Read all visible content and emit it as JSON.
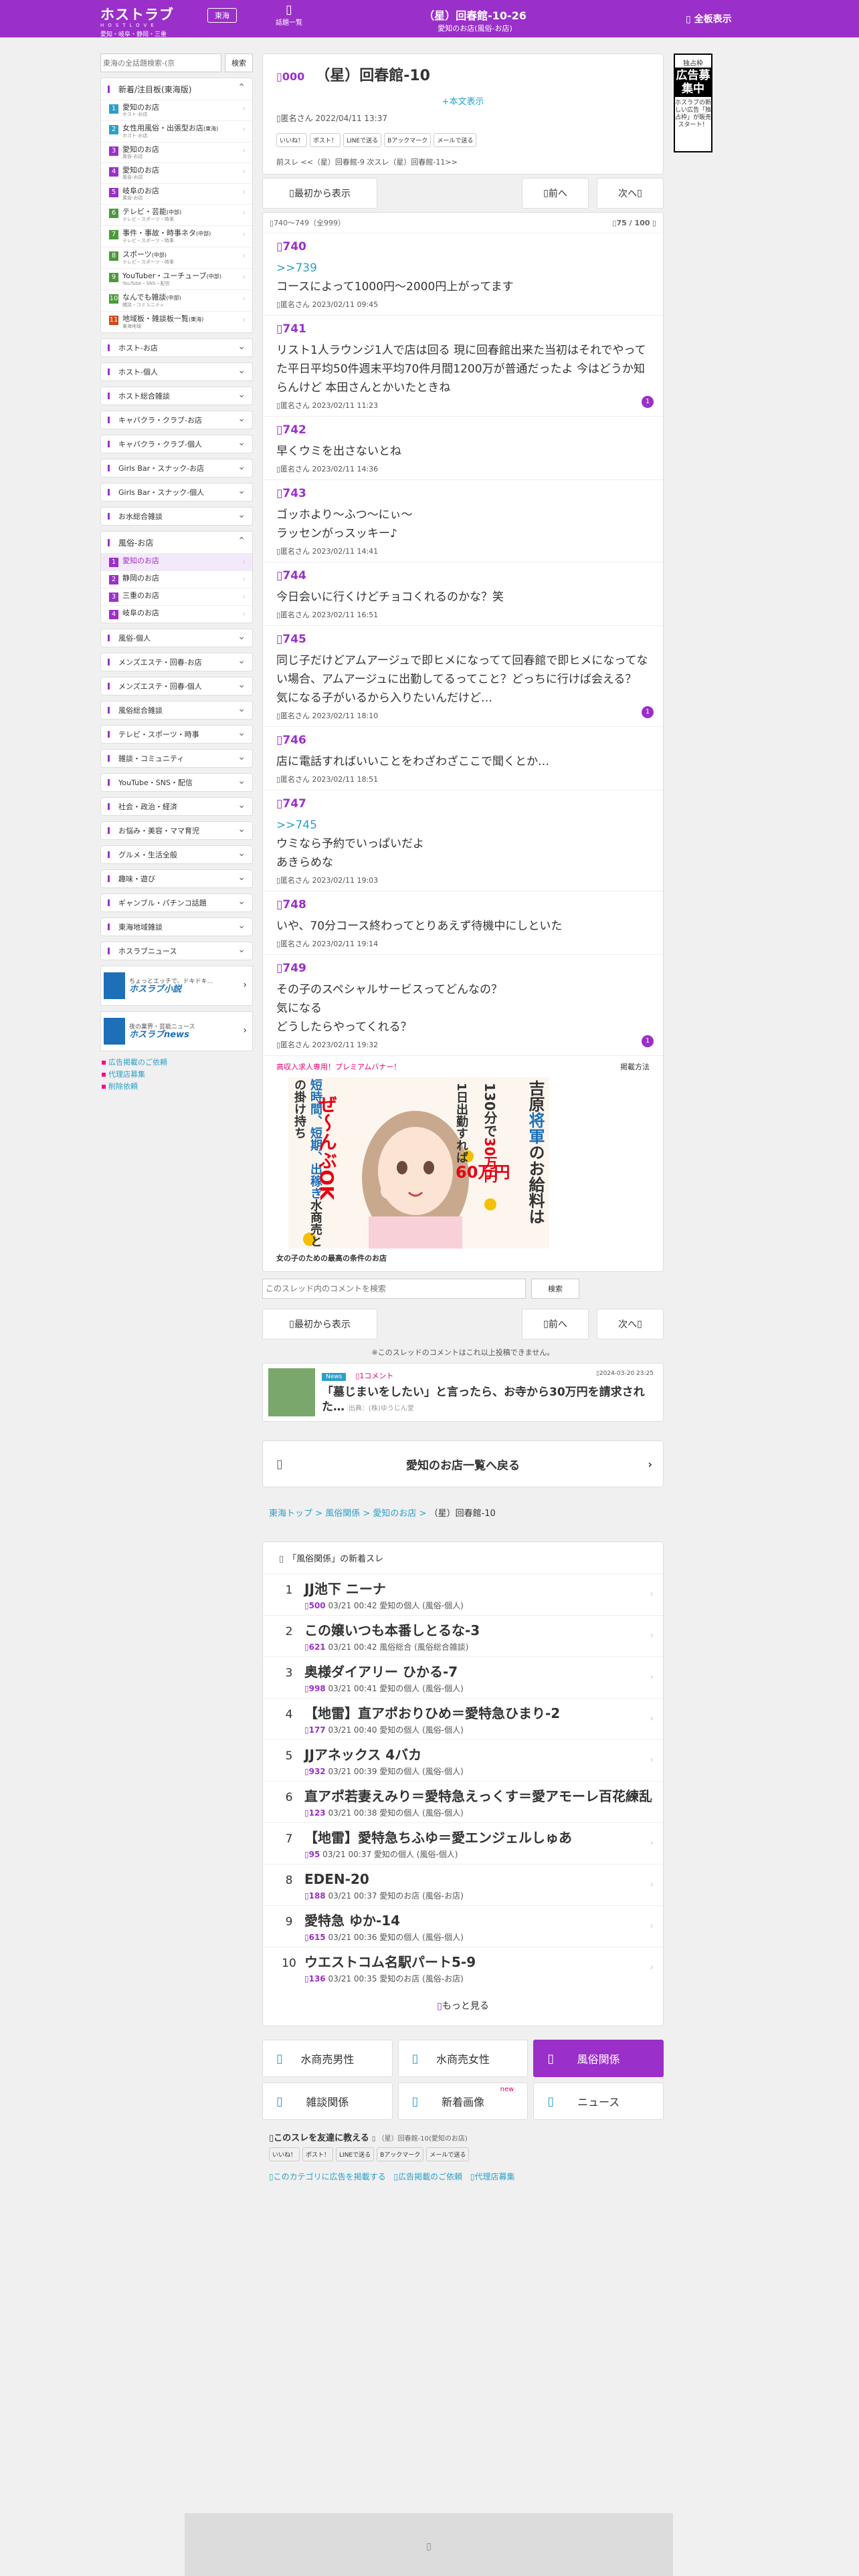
{
  "header": {
    "logo": "ホストラブ",
    "logo_sub": "HOSTLOVE",
    "area_caption": "愛知・岐阜・静岡・三重",
    "area_button": "東海",
    "thread_list": "話題一覧",
    "title": "（星）回春館-10-26",
    "subtitle": "愛知のお店(風俗-お店)",
    "menu": "全板表示"
  },
  "sidebar": {
    "search_placeholder": "東海の全話題検索-(京",
    "search_button": "検索",
    "group1": {
      "title": "新着/注目板(東海版)",
      "items": [
        {
          "n": "1",
          "label": "愛知のお店",
          "sub": "ホスト-お店",
          "color": "#2aa0c9"
        },
        {
          "n": "2",
          "label": "女性用風俗・出張型お店",
          "tag": "(東海)",
          "sub": "ホスト-お店",
          "color": "#2aa0c9"
        },
        {
          "n": "3",
          "label": "愛知のお店",
          "sub": "風俗-お店",
          "color": "#9b2fc9"
        },
        {
          "n": "4",
          "label": "愛知のお店",
          "sub": "風俗-お店",
          "color": "#9b2fc9"
        },
        {
          "n": "5",
          "label": "岐阜のお店",
          "sub": "風俗-お店",
          "color": "#9b2fc9"
        },
        {
          "n": "6",
          "label": "テレビ・芸能",
          "tag": "(中部)",
          "sub": "テレビ・スポーツ・時事",
          "color": "#4a9a3a"
        },
        {
          "n": "7",
          "label": "事件・事故・時事ネタ",
          "tag": "(中部)",
          "sub": "テレビ・スポーツ・時事",
          "color": "#4a9a3a"
        },
        {
          "n": "8",
          "label": "スポーツ",
          "tag": "(中部)",
          "sub": "テレビ・スポーツ・時事",
          "color": "#4a9a3a"
        },
        {
          "n": "9",
          "label": "YouTuber・ユーチューブ",
          "tag": "(中部)",
          "sub": "YouTube・SNS・配信",
          "color": "#4a9a3a"
        },
        {
          "n": "10",
          "label": "なんでも雑談",
          "tag": "(中部)",
          "sub": "雑談・コミュニティ",
          "color": "#4a9a3a"
        },
        {
          "n": "11",
          "label": "地域板・雑談板一覧",
          "tag": "(東海)",
          "sub": "東海地域",
          "color": "#d04a1a"
        }
      ]
    },
    "cats_a": [
      "ホスト-お店",
      "ホスト-個人",
      "ホスト総合雑談",
      "キャバクラ・クラブ-お店",
      "キャバクラ・クラブ-個人",
      "Girls Bar・スナック-お店",
      "Girls Bar・スナック-個人",
      "お水総合雑談"
    ],
    "open_group": {
      "title": "風俗-お店",
      "items": [
        {
          "n": "1",
          "label": "愛知のお店"
        },
        {
          "n": "2",
          "label": "静岡のお店"
        },
        {
          "n": "3",
          "label": "三重のお店"
        },
        {
          "n": "4",
          "label": "岐阜のお店"
        }
      ]
    },
    "cats_b": [
      "風俗-個人",
      "メンズエステ・回春-お店",
      "メンズエステ・回春-個人",
      "風俗総合雑談",
      "テレビ・スポーツ・時事",
      "雑談・コミュニティ",
      "YouTube・SNS・配信",
      "社会・政治・経済",
      "お悩み・美容・ママ育児",
      "グルメ・生活全般",
      "趣味・遊び",
      "ギャンブル・パチンコ話題",
      "東海地域雑談",
      "ホスラブニュース"
    ],
    "promos": [
      {
        "label": "ホスラブ小説",
        "text": "ちょっとエッチで、ドキドキ..."
      },
      {
        "label": "ホスラブnews",
        "text": "夜の業界・芸能ニュース"
      }
    ],
    "links": [
      "広告掲載のご依頼",
      "代理店募集",
      "削除依頼"
    ]
  },
  "right_ad": {
    "line1": "独占枠",
    "line2": "広告募集中",
    "line3": "ホスラブの新しい広告「独占枠」が販売スタート！"
  },
  "thread": {
    "no": "000",
    "title": "（星）回春館-10",
    "fav": "+本文表示",
    "meta": "匿名さん 2022/04/11 13:37",
    "share": [
      "いいね！",
      "ポスト！",
      "LINEで送る",
      "Bアックマーク",
      "メールで送る"
    ],
    "prev_next": "前スレ <<（星）回春館-9 次スレ（星）回春館-11>>",
    "btn_first": "最初から表示",
    "btn_prev": "前へ",
    "btn_next": "次へ",
    "page_range": "740～749（全999）",
    "page_count": "75 / 100"
  },
  "posts": [
    {
      "no": "740",
      "anchor": ">>739",
      "body": "コースによって1000円～2000円上がってます",
      "meta": "匿名さん 2023/02/11 09:45",
      "badge": ""
    },
    {
      "no": "741",
      "anchor": "",
      "body": "リスト1人ラウンジ1人で店は回る 現に回春館出来た当初はそれでやってた平日平均50件週末平均70件月間1200万が普通だったよ 今はどうか知らんけど 本田さんとかいたときね",
      "meta": "匿名さん 2023/02/11 11:23",
      "badge": "1"
    },
    {
      "no": "742",
      "anchor": "",
      "body": "早くウミを出さないとね",
      "meta": "匿名さん 2023/02/11 14:36",
      "badge": ""
    },
    {
      "no": "743",
      "anchor": "",
      "body": "ゴッホより～ふつ～にぃ～\nラッセンがっスッキー♪",
      "meta": "匿名さん 2023/02/11 14:41",
      "badge": ""
    },
    {
      "no": "744",
      "anchor": "",
      "body": "今日会いに行くけどチョコくれるのかな？笑",
      "meta": "匿名さん 2023/02/11 16:51",
      "badge": ""
    },
    {
      "no": "745",
      "anchor": "",
      "body": "同じ子だけどアムアージュで即ヒメになってて回春館で即ヒメになってない場合、アムアージュに出勤してるってこと？どっちに行けば会える？\n気になる子がいるから入りたいんだけど…",
      "meta": "匿名さん 2023/02/11 18:10",
      "badge": "1"
    },
    {
      "no": "746",
      "anchor": "",
      "body": "店に電話すればいいことをわざわざここで聞くとか…",
      "meta": "匿名さん 2023/02/11 18:51",
      "badge": ""
    },
    {
      "no": "747",
      "anchor": ">>745",
      "body": "ウミなら予約でいっぱいだよ\nあきらめな",
      "meta": "匿名さん 2023/02/11 19:03",
      "badge": ""
    },
    {
      "no": "748",
      "anchor": "",
      "body": "いや、70分コース終わってとりあえず待機中にしといた",
      "meta": "匿名さん 2023/02/11 19:14",
      "badge": ""
    },
    {
      "no": "749",
      "anchor": "",
      "body": "その子のスペシャルサービスってどんなの？\n気になる\nどうしたらやってくれる？",
      "meta": "匿名さん 2023/02/11 19:32",
      "badge": "1"
    }
  ],
  "ad": {
    "heading": "高収入求人専用！プレミアムバナー！",
    "how": "掲載方法",
    "banner_lines": [
      "吉原",
      "将軍",
      "のお給料は",
      "130分で",
      "30万円",
      "1日出勤すれば",
      "60万円",
      "短時間、短期、出稼ぎ",
      "水商売との掛け持ち",
      "ぜ～んぶOK"
    ],
    "caption": "女の子のための最高の条件のお店"
  },
  "comment_search": {
    "placeholder": "このスレッド内のコメントを検索",
    "button": "検索"
  },
  "note": "※このスレッドのコメントはこれ以上投稿できません。",
  "news": {
    "tag": "News",
    "comments": "1コメント",
    "date": "2024-03-20 23:25",
    "title": "「墓じまいをしたい」と言ったら、お寺から30万円を請求された…",
    "source": "出典：(株)ゆうじん堂"
  },
  "back_label": "愛知のお店一覧へ戻る",
  "breadcrumb": {
    "b1": "東海トップ",
    "b2": "風俗関係",
    "b3": "愛知のお店",
    "b4": "（星）回春館-10"
  },
  "ranking": {
    "head": "「風俗関係」の新着スレ",
    "items": [
      {
        "n": "1",
        "title": "JJ池下 ニーナ",
        "count": "500",
        "meta": "03/21 00:42 愛知の個人 (風俗-個人)"
      },
      {
        "n": "2",
        "title": "この嬢いつも本番しとるな-3",
        "count": "621",
        "meta": "03/21 00:42 風俗総合 (風俗総合雑談)"
      },
      {
        "n": "3",
        "title": "奥様ダイアリー ひかる-7",
        "count": "998",
        "meta": "03/21 00:41 愛知の個人 (風俗-個人)"
      },
      {
        "n": "4",
        "title": "【地雷】直アポおりひめ＝愛特急ひまり-2",
        "count": "177",
        "meta": "03/21 00:40 愛知の個人 (風俗-個人)"
      },
      {
        "n": "5",
        "title": "JJアネックス 4バカ",
        "count": "932",
        "meta": "03/21 00:39 愛知の個人 (風俗-個人)"
      },
      {
        "n": "6",
        "title": "直アポ若妻えみり＝愛特急えっくす＝愛アモーレ百花練乱",
        "count": "123",
        "meta": "03/21 00:38 愛知の個人 (風俗-個人)"
      },
      {
        "n": "7",
        "title": "【地雷】愛特急ちふゆ＝愛エンジェルしゅあ",
        "count": "95",
        "meta": "03/21 00:37 愛知の個人 (風俗-個人)"
      },
      {
        "n": "8",
        "title": "EDEN-20",
        "count": "188",
        "meta": "03/21 00:37 愛知のお店 (風俗-お店)"
      },
      {
        "n": "9",
        "title": "愛特急 ゆか-14",
        "count": "615",
        "meta": "03/21 00:36 愛知の個人 (風俗-個人)"
      },
      {
        "n": "10",
        "title": "ウエストコム名駅パート5-9",
        "count": "136",
        "meta": "03/21 00:35 愛知のお店 (風俗-お店)"
      }
    ],
    "more": "もっと見る"
  },
  "tabs": [
    {
      "label": "水商売男性",
      "on": false
    },
    {
      "label": "水商売女性",
      "on": false
    },
    {
      "label": "風俗関係",
      "on": true
    },
    {
      "label": "雑談関係",
      "on": false
    },
    {
      "label": "新着画像",
      "on": false,
      "new": "new"
    },
    {
      "label": "ニュース",
      "on": false
    }
  ],
  "share2": {
    "title": "このスレを友達に教える",
    "thread": "（星）回春館-10(愛知のお店)"
  },
  "footer_links": [
    "このカテゴリに広告を掲載する",
    "広告掲載のご依頼",
    "代理店募集"
  ],
  "colors": {
    "accent": "#9b2fc9",
    "link": "#2aa0c9",
    "pink": "#e60073"
  }
}
